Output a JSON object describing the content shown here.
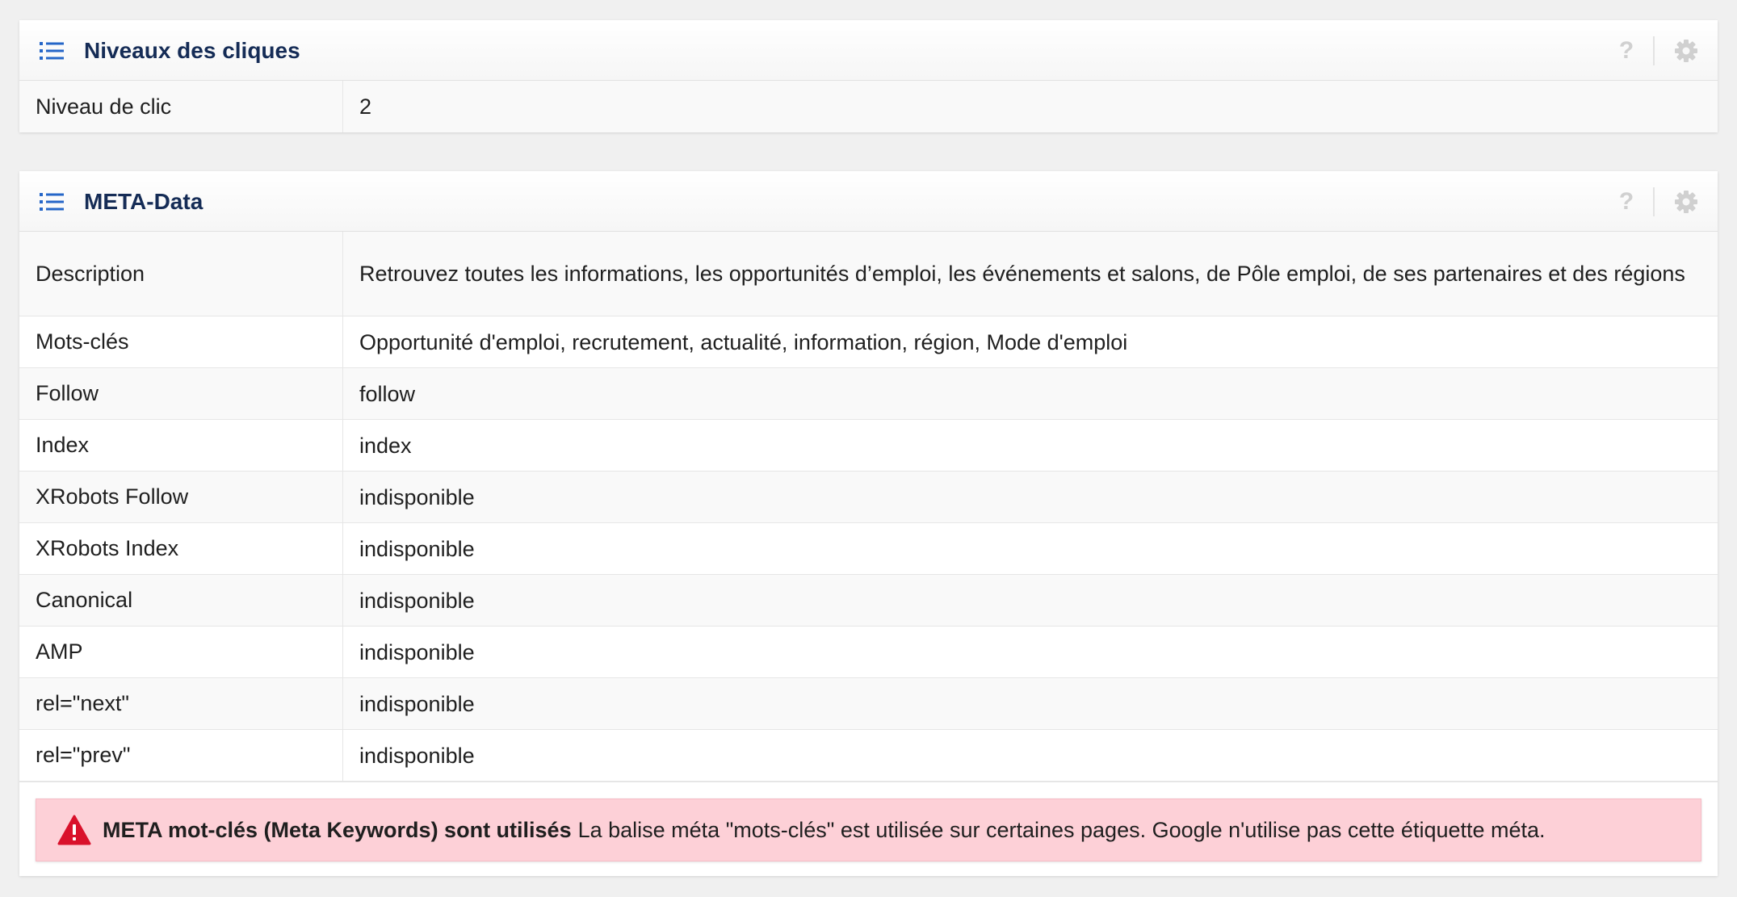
{
  "clicks_panel": {
    "title": "Niveaux des cliques",
    "help": "?",
    "rows": [
      {
        "label": "Niveau de clic",
        "value": "2"
      }
    ]
  },
  "meta_panel": {
    "title": "META-Data",
    "help": "?",
    "rows": [
      {
        "label": "Description",
        "value": "Retrouvez toutes les informations, les opportunités d’emploi, les événements et salons, de Pôle emploi, de ses partenaires et des régions"
      },
      {
        "label": "Mots-clés",
        "value": "Opportunité d'emploi, recrutement, actualité, information, région, Mode d'emploi"
      },
      {
        "label": "Follow",
        "value": "follow"
      },
      {
        "label": "Index",
        "value": "index"
      },
      {
        "label": "XRobots Follow",
        "value": "indisponible"
      },
      {
        "label": "XRobots Index",
        "value": "indisponible"
      },
      {
        "label": "Canonical",
        "value": "indisponible"
      },
      {
        "label": "AMP",
        "value": "indisponible"
      },
      {
        "label": "rel=\"next\"",
        "value": "indisponible"
      },
      {
        "label": "rel=\"prev\"",
        "value": "indisponible"
      }
    ],
    "alert": {
      "title": "META mot-clés (Meta Keywords) sont utilisés",
      "message": "La balise méta \"mots-clés\" est utilisée sur certaines pages. Google n'utilise pas cette étiquette méta.",
      "icon": "warning-icon"
    }
  },
  "colors": {
    "title": "#152c56",
    "list_icon": "#2566c8",
    "alert_bg": "#fdd0d7",
    "warning": "#d9112b"
  }
}
